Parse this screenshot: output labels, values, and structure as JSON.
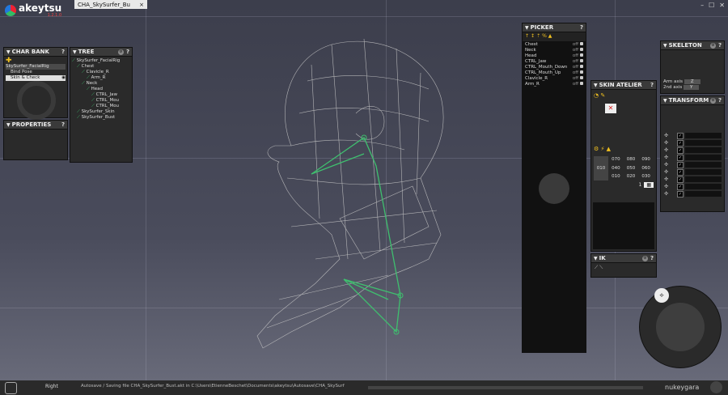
{
  "app": {
    "logo_text": "akeytsu",
    "version": "1.2.1.0",
    "brand": "nukeygara"
  },
  "tab": {
    "label": "CHA_SkySurfer_Bu",
    "close": "×"
  },
  "char_bank": {
    "title": "CHAR BANK",
    "item": "SkySurfer_FacialRig",
    "rows": [
      "Bind Pose",
      "Skin & Check"
    ]
  },
  "tree": {
    "title": "TREE",
    "items": [
      {
        "label": "SkySurfer_FacialRig",
        "depth": 0
      },
      {
        "label": "Chest",
        "depth": 1
      },
      {
        "label": "Clavicle_R",
        "depth": 2
      },
      {
        "label": "Arm_R",
        "depth": 3
      },
      {
        "label": "Neck",
        "depth": 2
      },
      {
        "label": "Head",
        "depth": 3
      },
      {
        "label": "CTRL_Jaw",
        "depth": 4
      },
      {
        "label": "CTRL_Mou",
        "depth": 4
      },
      {
        "label": "CTRL_Mou",
        "depth": 4
      },
      {
        "label": "SkySurfer_Skin",
        "depth": 1
      },
      {
        "label": "SkySurfer_Bust",
        "depth": 1
      }
    ]
  },
  "properties": {
    "title": "PROPERTIES"
  },
  "picker": {
    "title": "PICKER",
    "items": [
      {
        "name": "Chest",
        "state": "off"
      },
      {
        "name": "Neck",
        "state": "off"
      },
      {
        "name": "Head",
        "state": "off"
      },
      {
        "name": "CTRL_Jaw",
        "state": "off"
      },
      {
        "name": "CTRL_Mouth_Down",
        "state": "off"
      },
      {
        "name": "CTRL_Mouth_Up",
        "state": "off"
      },
      {
        "name": "Clavicle_R",
        "state": "off"
      },
      {
        "name": "Arm_R",
        "state": "off"
      }
    ]
  },
  "skeleton": {
    "title": "SKELETON",
    "arm_axis_label": "Arm axis",
    "arm_axis_value": "Z",
    "second_axis_label": "2nd axis",
    "second_axis_value": "Y"
  },
  "skin_atelier": {
    "title": "SKIN ATELIER",
    "left_value": "010",
    "grid": [
      [
        "070",
        "080",
        "090"
      ],
      [
        "040",
        "050",
        "060"
      ],
      [
        "010",
        "020",
        "030"
      ]
    ],
    "count": "1"
  },
  "transform": {
    "title": "TRANSFORM"
  },
  "ik": {
    "title": "IK"
  },
  "status": {
    "view_label": "Right",
    "message": "Autosave / Saving file CHA_SkySurfer_Bust.akt in C:\\Users\\EtienneBeschet\\Documents\\akeytsu\\Autosave\\CHA_SkySurf"
  },
  "colors": {
    "accent_green": "#3fbf6f",
    "accent_yellow": "#f0c020"
  }
}
